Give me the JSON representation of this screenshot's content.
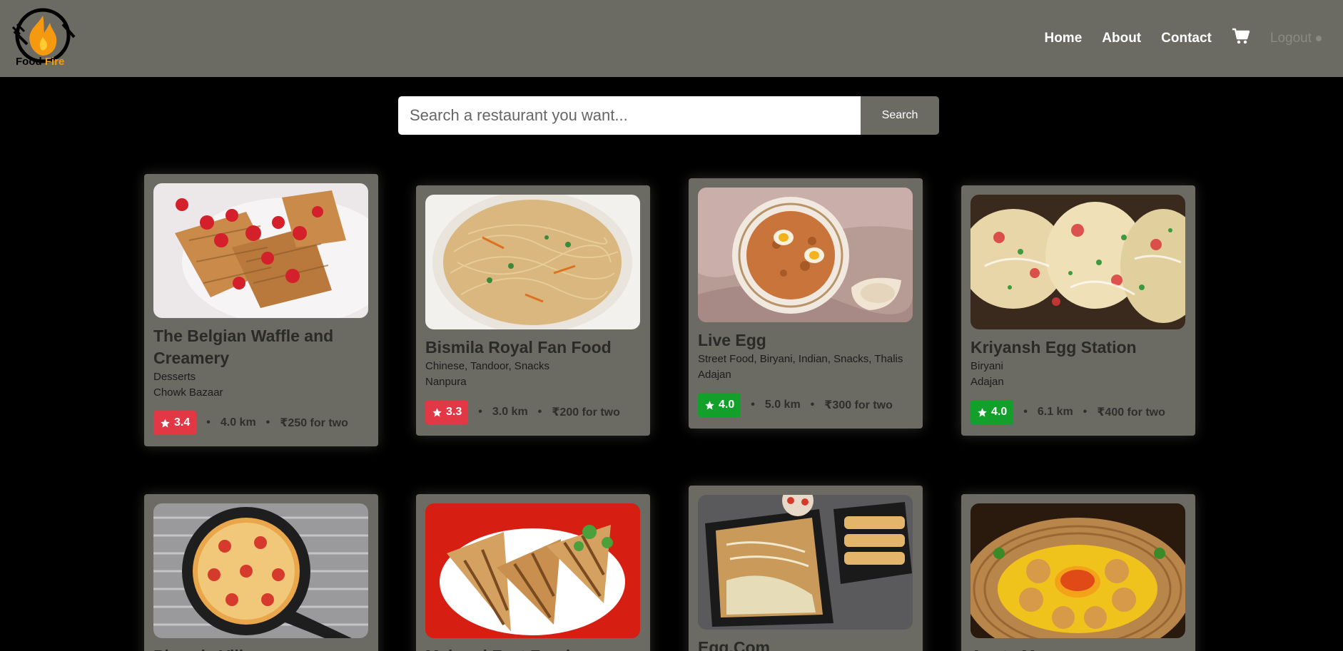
{
  "header": {
    "logo_text_1": "Food",
    "logo_text_2": "Fire",
    "nav": {
      "home": "Home",
      "about": "About",
      "contact": "Contact",
      "logout": "Logout"
    },
    "cart_icon": "cart-icon"
  },
  "search": {
    "placeholder": "Search a restaurant you want...",
    "button_label": "Search"
  },
  "colors": {
    "header_bg": "#6b6b63",
    "rating_low": "#e23744",
    "rating_high": "#12a02a"
  },
  "restaurants": [
    {
      "name": "The Belgian Waffle and Creamery",
      "cuisine": "Desserts",
      "area": "Chowk Bazaar",
      "rating": "3.4",
      "distance": "4.0 km",
      "cost": "₹250 for two"
    },
    {
      "name": "Bismila Royal Fan Food",
      "cuisine": "Chinese, Tandoor, Snacks",
      "area": "Nanpura",
      "rating": "3.3",
      "distance": "3.0 km",
      "cost": "₹200 for two"
    },
    {
      "name": "Live Egg",
      "cuisine": "Street Food, Biryani, Indian, Snacks, Thalis",
      "area": "Adajan",
      "rating": "4.0",
      "distance": "5.0 km",
      "cost": "₹300 for two"
    },
    {
      "name": "Kriyansh Egg Station",
      "cuisine": "Biryani",
      "area": "Adajan",
      "rating": "4.0",
      "distance": "6.1 km",
      "cost": "₹400 for two"
    },
    {
      "name": "Pizzeria Vill"
    },
    {
      "name": "Maharaj Fast Food"
    },
    {
      "name": "Egg.Com"
    },
    {
      "name": "Aunty Momos"
    }
  ]
}
